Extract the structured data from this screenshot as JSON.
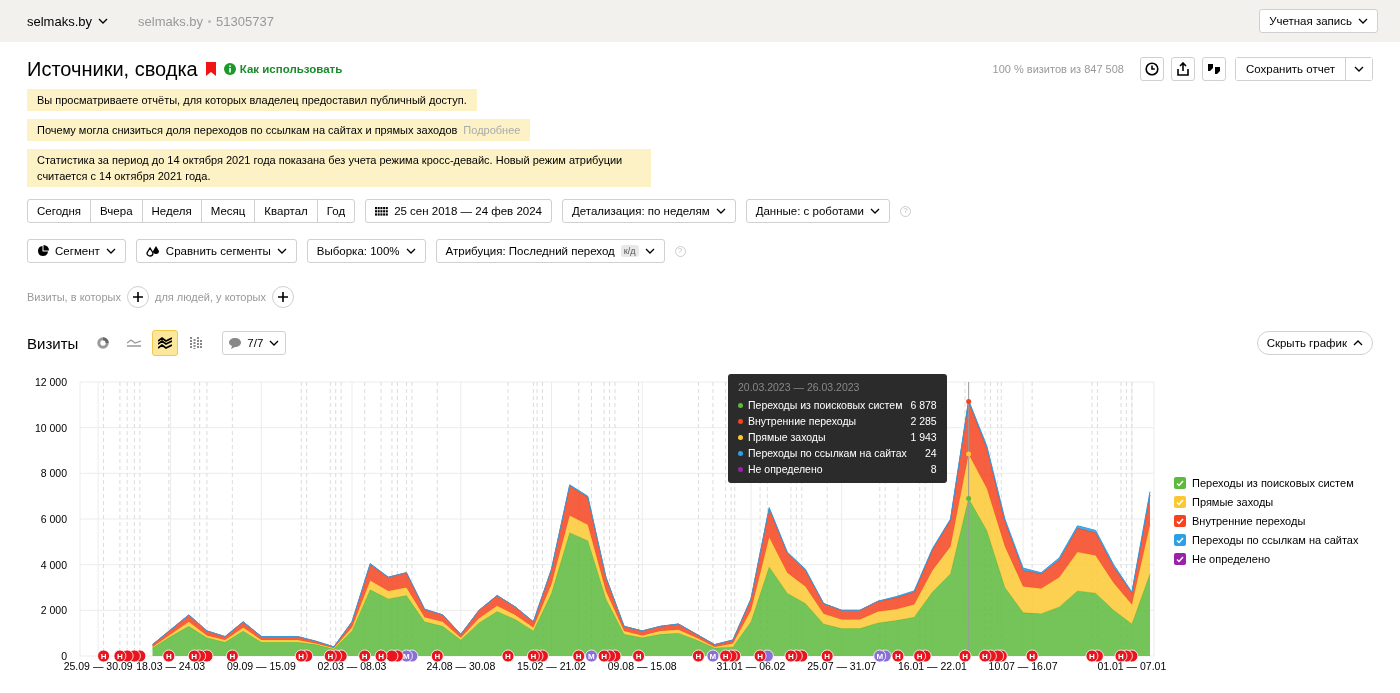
{
  "topbar": {
    "site_selector": "selmaks.by",
    "breadcrumb": [
      "selmaks.by",
      "51305737"
    ],
    "account_button": "Учетная запись"
  },
  "header": {
    "title": "Источники, сводка",
    "help_link": "Как использовать",
    "sample_info": "100 % визитов из 847 508",
    "save_button": "Сохранить отчет"
  },
  "notices": [
    {
      "text": "Вы просматриваете отчёты, для которых владелец предоставил публичный доступ."
    },
    {
      "text": "Почему могла снизиться доля переходов по ссылкам на сайтах и прямых заходов",
      "link": "Подробнее"
    },
    {
      "text": "Статистика за период до 14 октября 2021 года показана без учета режима кросс-девайс. Новый режим атрибуции считается с 14 октября 2021 года."
    }
  ],
  "period_buttons": [
    "Сегодня",
    "Вчера",
    "Неделя",
    "Месяц",
    "Квартал",
    "Год"
  ],
  "date_range": "25 сен 2018 — 24 фев 2024",
  "detail_dropdown": "Детализация: по неделям",
  "data_dropdown": "Данные: с роботами",
  "help_mark": "?",
  "segment_row": {
    "segment": "Сегмент",
    "compare": "Сравнить сегменты",
    "sample": "Выборка: 100%",
    "attribution": "Атрибуция: Последний переход",
    "attribution_badge": "к/д"
  },
  "filters": [
    "Визиты, в которых",
    "для людей, у которых"
  ],
  "chart": {
    "title": "Визиты",
    "type_buttons": [
      {
        "kind": "pie",
        "selected": false
      },
      {
        "kind": "line",
        "selected": false
      },
      {
        "kind": "area",
        "selected": true
      },
      {
        "kind": "bar",
        "selected": false
      }
    ],
    "comments": "7/7",
    "hide_button": "Скрыть график",
    "chart_data": {
      "type": "area",
      "stacked": true,
      "grid": true,
      "categories": [
        null,
        "25.09 — 30.09",
        null,
        null,
        null,
        "18.03 — 24.03",
        null,
        null,
        null,
        null,
        "09.09 — 15.09",
        null,
        null,
        null,
        null,
        "02.03 — 08.03",
        null,
        null,
        null,
        null,
        null,
        "24.08 — 30.08",
        null,
        null,
        null,
        null,
        "15.02 — 21.02",
        null,
        null,
        null,
        null,
        "09.08 — 15.08",
        null,
        null,
        null,
        null,
        null,
        "31.01 — 06.02",
        null,
        null,
        null,
        null,
        "25.07 — 31.07",
        null,
        null,
        null,
        null,
        "16.01 — 22.01",
        null,
        null,
        null,
        null,
        "10.07 — 16.07",
        null,
        null,
        null,
        null,
        null,
        "01.01 — 07.01",
        null
      ],
      "ylim": [
        0,
        12000
      ],
      "yticks": [
        {
          "value": 0,
          "label": "0"
        },
        {
          "value": 2000,
          "label": "2 000"
        },
        {
          "value": 4000,
          "label": "4 000"
        },
        {
          "value": 6000,
          "label": "6 000"
        },
        {
          "value": 8000,
          "label": "8 000"
        },
        {
          "value": 10000,
          "label": "10 000"
        },
        {
          "value": 12000,
          "label": "12 000"
        }
      ],
      "series": [
        {
          "name": "Переходы из поисковых систем",
          "color": "#5cba3c",
          "values": [
            null,
            null,
            null,
            null,
            350,
            850,
            1300,
            800,
            600,
            1100,
            600,
            600,
            600,
            500,
            300,
            1100,
            2900,
            2500,
            2650,
            1500,
            1300,
            700,
            1450,
            1950,
            1600,
            1100,
            2750,
            5400,
            5050,
            2500,
            950,
            800,
            950,
            1000,
            700,
            350,
            400,
            1500,
            3900,
            2750,
            2300,
            1400,
            1200,
            1200,
            1450,
            1550,
            1700,
            2800,
            3600,
            6900,
            5500,
            3000,
            1900,
            1850,
            2150,
            2850,
            2750,
            2000,
            1400,
            3600
          ]
        },
        {
          "name": "Прямые заходы",
          "color": "#fcc832",
          "values": [
            null,
            null,
            null,
            null,
            50,
            100,
            200,
            100,
            100,
            150,
            100,
            100,
            100,
            50,
            50,
            150,
            400,
            350,
            350,
            200,
            200,
            100,
            200,
            250,
            200,
            150,
            400,
            750,
            700,
            350,
            150,
            100,
            150,
            150,
            100,
            50,
            150,
            500,
            1300,
            900,
            750,
            450,
            400,
            400,
            500,
            500,
            550,
            950,
            1200,
            1950,
            1850,
            1800,
            1150,
            1100,
            1300,
            1700,
            1650,
            1200,
            850,
            2150
          ]
        },
        {
          "name": "Внутренние переходы",
          "color": "#f5431f",
          "values": [
            null,
            null,
            null,
            null,
            100,
            200,
            300,
            200,
            150,
            250,
            150,
            150,
            150,
            100,
            50,
            250,
            700,
            600,
            650,
            350,
            300,
            150,
            350,
            450,
            350,
            250,
            650,
            1300,
            1200,
            600,
            200,
            200,
            200,
            250,
            150,
            100,
            150,
            500,
            1250,
            850,
            700,
            450,
            400,
            400,
            450,
            500,
            550,
            900,
            1150,
            2300,
            1750,
            1100,
            700,
            650,
            750,
            1050,
            1000,
            700,
            500,
            1300
          ]
        },
        {
          "name": "Переходы по ссылкам на сайтах",
          "color": "#2c9fe6",
          "values": [
            null,
            null,
            null,
            null,
            0,
            0,
            0,
            0,
            0,
            0,
            0,
            0,
            0,
            0,
            0,
            0,
            50,
            0,
            0,
            0,
            0,
            0,
            0,
            0,
            0,
            0,
            0,
            50,
            50,
            0,
            0,
            0,
            0,
            0,
            0,
            0,
            0,
            0,
            50,
            50,
            50,
            0,
            0,
            0,
            0,
            50,
            50,
            50,
            50,
            50,
            100,
            100,
            100,
            50,
            100,
            100,
            100,
            100,
            50,
            150
          ]
        },
        {
          "name": "Не определено",
          "color": "#9a22a8",
          "values": [
            null,
            null,
            null,
            null,
            null,
            null,
            null,
            null,
            null,
            null,
            null,
            null,
            null,
            null,
            null,
            null,
            null,
            null,
            null,
            null,
            null,
            null,
            null,
            null,
            null,
            null,
            null,
            null,
            null,
            null,
            null,
            null,
            null,
            null,
            null,
            null,
            null,
            null,
            null,
            null,
            null,
            null,
            null,
            null,
            null,
            null,
            null,
            null,
            null,
            null,
            null,
            null,
            null,
            null,
            null,
            null,
            null,
            null,
            null,
            null
          ]
        }
      ]
    },
    "events": [
      {
        "text": "Н",
        "kind": "note"
      },
      {
        "text": "Н",
        "kind": "note"
      },
      {
        "kind": "note"
      },
      {
        "kind": "note"
      },
      {
        "kind": "note"
      },
      {
        "text": "Н",
        "kind": "note"
      },
      {
        "text": "Н",
        "kind": "note"
      },
      {
        "kind": "note"
      },
      {
        "kind": "note"
      },
      {
        "text": "Н",
        "kind": "note"
      },
      {
        "text": "Н",
        "kind": "note"
      },
      {
        "kind": "note"
      },
      {
        "text": "Н",
        "kind": "note"
      },
      {
        "kind": "note"
      },
      {
        "kind": "note"
      },
      {
        "text": "Н",
        "kind": "note"
      },
      {
        "text": "Н",
        "kind": "note"
      },
      {
        "kind": "note"
      },
      {
        "kind": "note"
      },
      {
        "text": "М",
        "kind": "mark"
      },
      {
        "kind": "mark"
      },
      {
        "text": "Н",
        "kind": "note"
      },
      {
        "text": "Н",
        "kind": "note"
      },
      {
        "text": "Н",
        "kind": "note"
      },
      {
        "kind": "note"
      },
      {
        "kind": "note"
      },
      {
        "text": "Н",
        "kind": "note"
      },
      {
        "text": "М",
        "kind": "mark"
      },
      {
        "text": "Н",
        "kind": "note"
      },
      {
        "kind": "note"
      },
      {
        "kind": "note"
      },
      {
        "text": "Н",
        "kind": "note"
      },
      {
        "text": "Н",
        "kind": "note"
      },
      {
        "text": "М",
        "kind": "mark"
      },
      {
        "text": "Н",
        "kind": "note"
      },
      {
        "kind": "note"
      },
      {
        "kind": "note"
      },
      {
        "text": "Н",
        "kind": "note"
      },
      {
        "kind": "mark"
      },
      {
        "text": "Н",
        "kind": "note"
      },
      {
        "kind": "note"
      },
      {
        "kind": "note"
      },
      {
        "text": "Н",
        "kind": "note"
      },
      {
        "text": "М",
        "kind": "mark"
      },
      {
        "kind": "mark"
      },
      {
        "text": "Н",
        "kind": "note"
      },
      {
        "text": "Н",
        "kind": "note"
      },
      {
        "kind": "note"
      },
      {
        "text": "Н",
        "kind": "note"
      },
      {
        "text": "Н",
        "kind": "note"
      },
      {
        "kind": "note"
      },
      {
        "kind": "note"
      },
      {
        "kind": "note"
      },
      {
        "text": "Н",
        "kind": "note"
      },
      {
        "text": "Н",
        "kind": "note"
      },
      {
        "kind": "note"
      },
      {
        "text": "Н",
        "kind": "note"
      },
      {
        "kind": "note"
      },
      {
        "kind": "note"
      }
    ],
    "tooltip": {
      "title": "20.03.2023 — 26.03.2023",
      "rows": [
        {
          "label": "Переходы из поисковых систем",
          "value": "6 878",
          "color": "#5cba3c"
        },
        {
          "label": "Внутренние переходы",
          "value": "2 285",
          "color": "#f5431f"
        },
        {
          "label": "Прямые заходы",
          "value": "1 943",
          "color": "#fcc832"
        },
        {
          "label": "Переходы по ссылкам на сайтах",
          "value": "24",
          "color": "#2c9fe6"
        },
        {
          "label": "Не определено",
          "value": "8",
          "color": "#9a22a8"
        }
      ]
    }
  }
}
